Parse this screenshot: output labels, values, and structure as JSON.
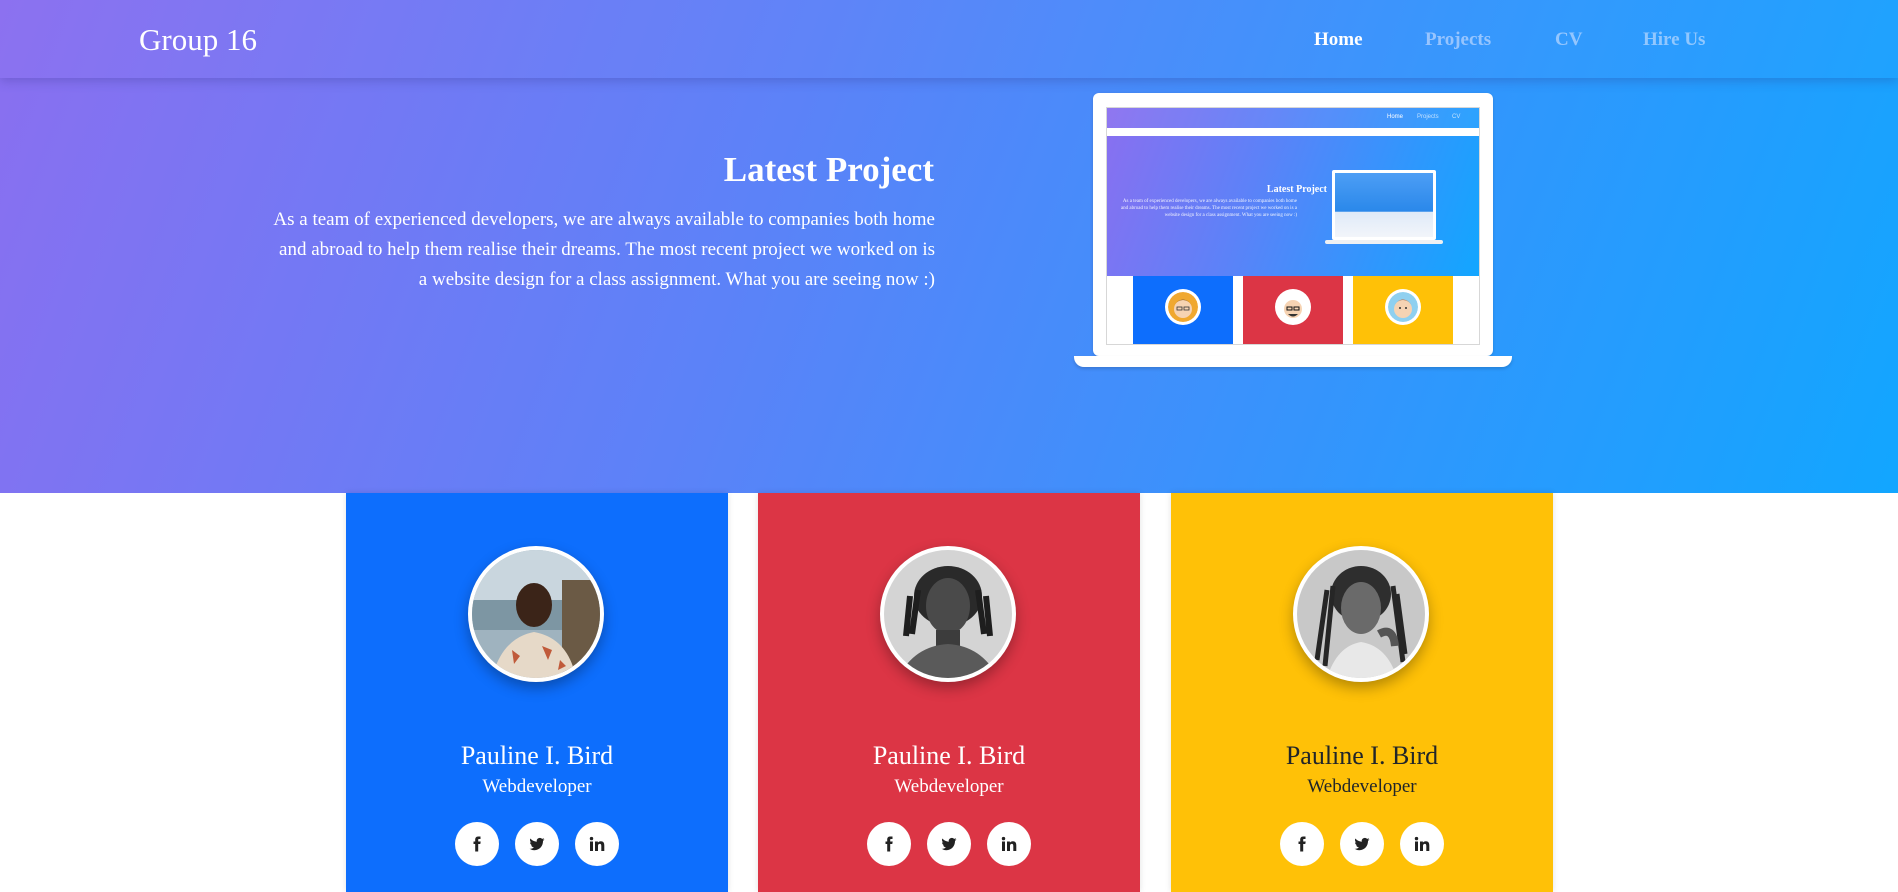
{
  "brand": "Group 16",
  "nav": {
    "home": "Home",
    "projects": "Projects",
    "cv": "CV",
    "hire": "Hire Us"
  },
  "hero": {
    "title": "Latest Project",
    "text": "As a team of experienced developers, we are always available to companies both home and abroad to help them realise their dreams. The most recent project we worked on is a website design for a class assignment. What you are seeing now :)"
  },
  "mockup": {
    "nav": [
      "Home",
      "Projects",
      "CV"
    ],
    "title": "Latest Project",
    "text": "As a team of experienced developers, we are always available to companies both home and abroad to help them realise their dreams. The most recent project we worked on is a website design for a class assignment. What you are seeing now :)"
  },
  "team": [
    {
      "name": "Pauline I. Bird",
      "role": "Webdeveloper",
      "color": "#0d6efd",
      "text_color": "#ffffff"
    },
    {
      "name": "Pauline I. Bird",
      "role": "Webdeveloper",
      "color": "#dc3545",
      "text_color": "#ffffff"
    },
    {
      "name": "Pauline I. Bird",
      "role": "Webdeveloper",
      "color": "#ffc107",
      "text_color": "#212529"
    }
  ],
  "socials": [
    "facebook-icon",
    "twitter-icon",
    "linkedin-icon"
  ],
  "colors": {
    "gradient_start": "#8a6ff0",
    "gradient_end": "#12a6ff"
  }
}
